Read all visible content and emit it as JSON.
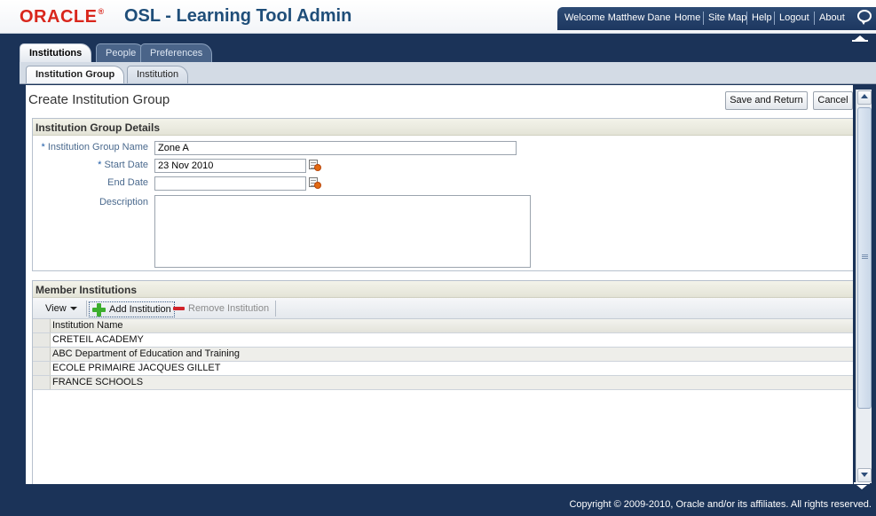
{
  "header": {
    "logo": "ORACLE",
    "logo_mark": "®",
    "app_title": "OSL - Learning Tool Admin",
    "welcome": "Welcome Matthew Dane",
    "links": [
      "Home",
      "Site Map",
      "Help",
      "Logout",
      "About"
    ]
  },
  "tabs_level1": [
    {
      "label": "Institutions",
      "active": true
    },
    {
      "label": "People",
      "active": false
    },
    {
      "label": "Preferences",
      "active": false
    }
  ],
  "tabs_level2": [
    {
      "label": "Institution Group",
      "active": true
    },
    {
      "label": "Institution",
      "active": false
    }
  ],
  "page": {
    "title": "Create Institution Group",
    "save_button": "Save and Return",
    "cancel_button": "Cancel"
  },
  "details": {
    "header": "Institution Group Details",
    "required_marker": "*",
    "name_label": "Institution Group Name",
    "name_value": "Zone A",
    "start_label": "Start Date",
    "start_value": "23 Nov 2010",
    "end_label": "End Date",
    "end_value": "",
    "description_label": "Description",
    "description_value": ""
  },
  "members": {
    "header": "Member Institutions",
    "view_menu": "View",
    "add_button": "Add Institution",
    "remove_button": "Remove Institution",
    "column_header": "Institution Name",
    "rows": [
      "CRETEIL ACADEMY",
      "ABC Department of Education and Training",
      "ECOLE PRIMAIRE JACQUES GILLET",
      "FRANCE SCHOOLS"
    ]
  },
  "footer": {
    "copyright": "Copyright © 2009-2010, Oracle and/or its affiliates. All rights reserved."
  },
  "colors": {
    "oracle_red": "#d9261c",
    "title_blue": "#1f4e79",
    "navy": "#1b3358"
  }
}
